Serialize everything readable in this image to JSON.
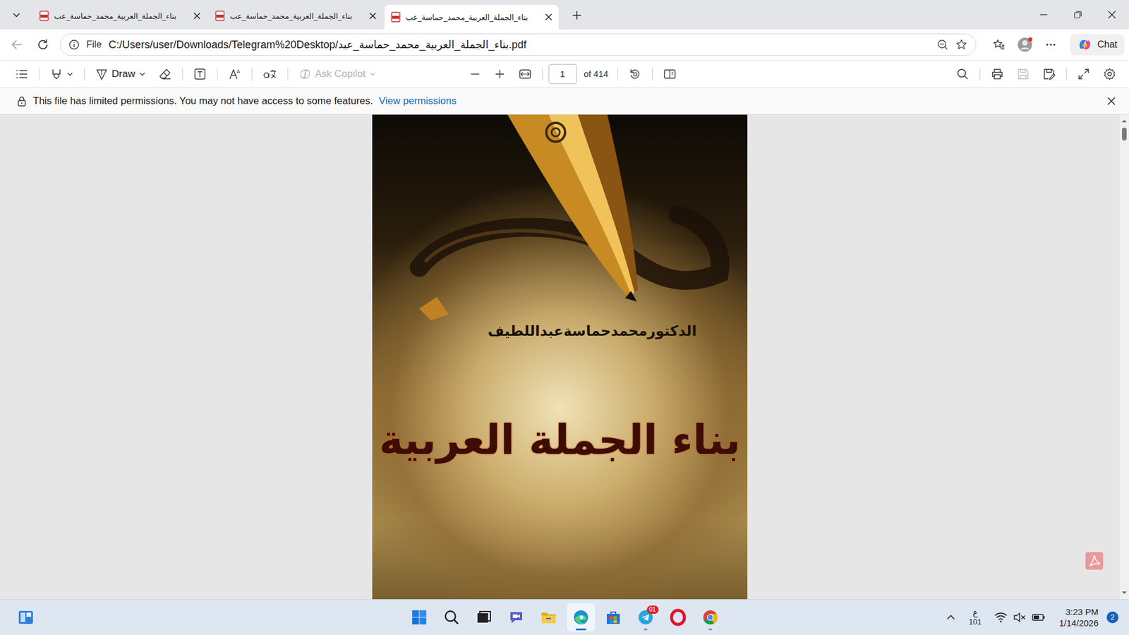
{
  "window": {
    "tabs": [
      {
        "label": "بناء_الجملة_العربية_محمد_حماسة_عب",
        "selected": false
      },
      {
        "label": "بناء_الجملة_العربية_محمد_حماسة_عب",
        "selected": false
      },
      {
        "label": "بناء_الجملة_العربية_محمد_حماسة_عب",
        "selected": true
      }
    ]
  },
  "address_bar": {
    "scheme": "File",
    "url": "C:/Users/user/Downloads/Telegram%20Desktop/بناء_الجملة_العربية_محمد_حماسة_عبد.pdf"
  },
  "chat_button": "Chat",
  "pdf_toolbar": {
    "draw": "Draw",
    "ask_copilot": "Ask Copilot",
    "ask_copilot_disabled": true,
    "page": "1",
    "page_count": "of 414",
    "save_disabled": true
  },
  "permission_bar": {
    "message": "This file has limited permissions. You may not have access to some features.",
    "link": "View permissions"
  },
  "page": {
    "author": "الدكتورمحمدحماسةعبداللطيف",
    "title": "بناء الجملة العربية"
  },
  "taskbar": {
    "input_indicator": "ع",
    "input_sub": "101",
    "time": "3:23 PM",
    "date": "1/14/2026",
    "notification_count": "2",
    "apps": [
      {
        "kind": "start",
        "selected": false,
        "running": false,
        "badge": ""
      },
      {
        "kind": "search",
        "selected": false,
        "running": false,
        "badge": ""
      },
      {
        "kind": "taskview",
        "selected": false,
        "running": false,
        "badge": ""
      },
      {
        "kind": "meet",
        "selected": false,
        "running": false,
        "badge": ""
      },
      {
        "kind": "explorer",
        "selected": false,
        "running": false,
        "badge": ""
      },
      {
        "kind": "edge",
        "selected": true,
        "running": true,
        "badge": ""
      },
      {
        "kind": "store",
        "selected": false,
        "running": false,
        "badge": ""
      },
      {
        "kind": "telegram",
        "selected": false,
        "running": true,
        "badge": "01"
      },
      {
        "kind": "opera",
        "selected": false,
        "running": false,
        "badge": ""
      },
      {
        "kind": "chrome",
        "selected": false,
        "running": true,
        "badge": ""
      }
    ]
  }
}
